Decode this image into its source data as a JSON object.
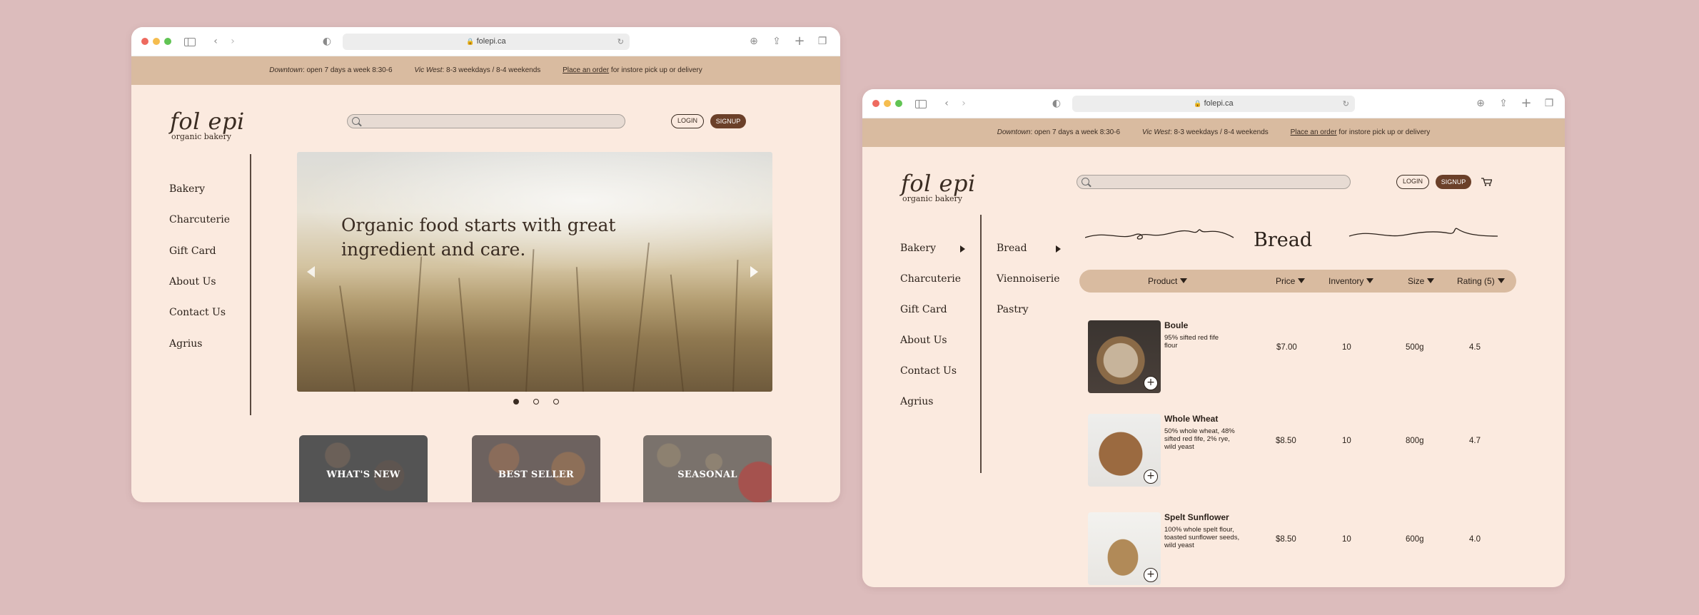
{
  "browser": {
    "url": "folepi.ca"
  },
  "banner": {
    "downtown_label": "Downtown",
    "downtown_text": ": open 7 days a week 8:30-6",
    "vicwest_label": "Vic West",
    "vicwest_text": ": 8-3 weekdays / 8-4 weekends",
    "order_link": "Place an order",
    "order_text": " for instore pick up or delivery"
  },
  "logo": {
    "main": "fol epi",
    "sub": "organic bakery"
  },
  "auth": {
    "login": "LOGIN",
    "signup": "SIGNUP"
  },
  "nav": {
    "items": [
      "Bakery",
      "Charcuterie",
      "Gift Card",
      "About Us",
      "Contact Us",
      "Agrius"
    ]
  },
  "home": {
    "hero_text": "Organic food starts with great ingredient and care.",
    "tiles": [
      "WHAT'S NEW",
      "BEST SELLER",
      "SEASONAL"
    ]
  },
  "category": {
    "subnav": [
      "Bread",
      "Viennoiserie",
      "Pastry"
    ],
    "title": "Bread",
    "columns": [
      "Product",
      "Price",
      "Inventory",
      "Size",
      "Rating (5)"
    ],
    "products": [
      {
        "name": "Boule",
        "desc": "95% sifted red fife flour",
        "price": "$7.00",
        "inventory": "10",
        "size": "500g",
        "rating": "4.5"
      },
      {
        "name": "Whole Wheat",
        "desc": "50% whole wheat, 48% sifted red fife, 2% rye, wild yeast",
        "price": "$8.50",
        "inventory": "10",
        "size": "800g",
        "rating": "4.7"
      },
      {
        "name": "Spelt Sunflower",
        "desc": "100% whole spelt flour, toasted sunflower seeds, wild yeast",
        "price": "$8.50",
        "inventory": "10",
        "size": "600g",
        "rating": "4.0"
      }
    ]
  },
  "icons": {
    "search": "search-icon",
    "cart": "cart-icon",
    "add": "plus-icon",
    "caret": "caret-down-icon",
    "submenu": "triangle-right-icon"
  },
  "colors": {
    "background": "#dcbcbc",
    "page": "#fbeadf",
    "banner": "#d9bba0",
    "accent": "#6b4029",
    "text": "#2b211a"
  }
}
